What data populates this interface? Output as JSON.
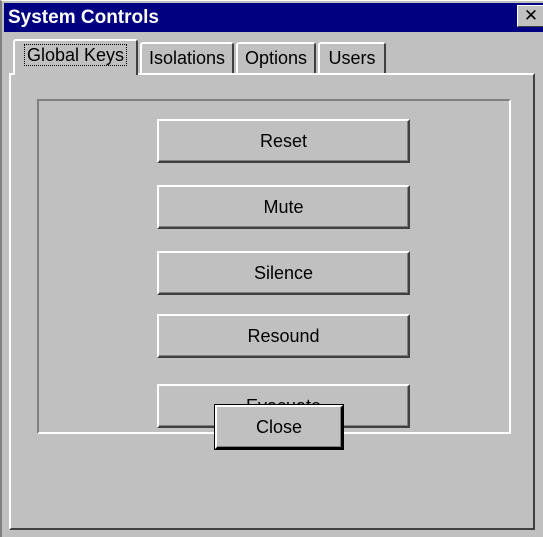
{
  "window": {
    "title": "System Controls",
    "close_glyph": "✕"
  },
  "tabs": [
    {
      "label": "Global Keys",
      "active": true
    },
    {
      "label": "Isolations",
      "active": false
    },
    {
      "label": "Options",
      "active": false
    },
    {
      "label": "Users",
      "active": false
    }
  ],
  "global_keys": {
    "buttons": [
      {
        "label": "Reset"
      },
      {
        "label": "Mute"
      },
      {
        "label": "Silence"
      },
      {
        "label": "Resound"
      },
      {
        "label": "Evacuate"
      }
    ]
  },
  "footer": {
    "close_label": "Close"
  },
  "colors": {
    "title_bar": "#000080",
    "face": "#c0c0c0"
  }
}
